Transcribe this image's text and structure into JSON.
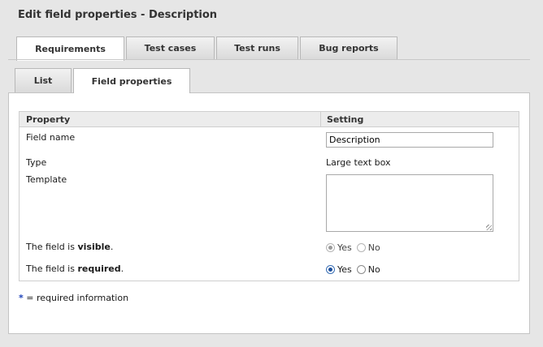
{
  "page": {
    "title": "Edit field properties - Description"
  },
  "top_tabs": [
    {
      "label": "Requirements",
      "active": true
    },
    {
      "label": "Test cases",
      "active": false
    },
    {
      "label": "Test runs",
      "active": false
    },
    {
      "label": "Bug reports",
      "active": false
    }
  ],
  "sub_tabs": [
    {
      "label": "List",
      "active": false
    },
    {
      "label": "Field properties",
      "active": true
    }
  ],
  "table": {
    "header_property": "Property",
    "header_setting": "Setting",
    "field_name_label": "Field name",
    "field_name_value": "Description",
    "type_label": "Type",
    "type_value": "Large text box",
    "template_label": "Template",
    "template_value": "",
    "visible_prefix": "The field is ",
    "visible_bold": "visible",
    "visible_suffix": ".",
    "required_prefix": "The field is ",
    "required_bold": "required",
    "required_suffix": ".",
    "yes_label": "Yes",
    "no_label": "No"
  },
  "footer": {
    "asterisk": "*",
    "note": " = required information"
  }
}
